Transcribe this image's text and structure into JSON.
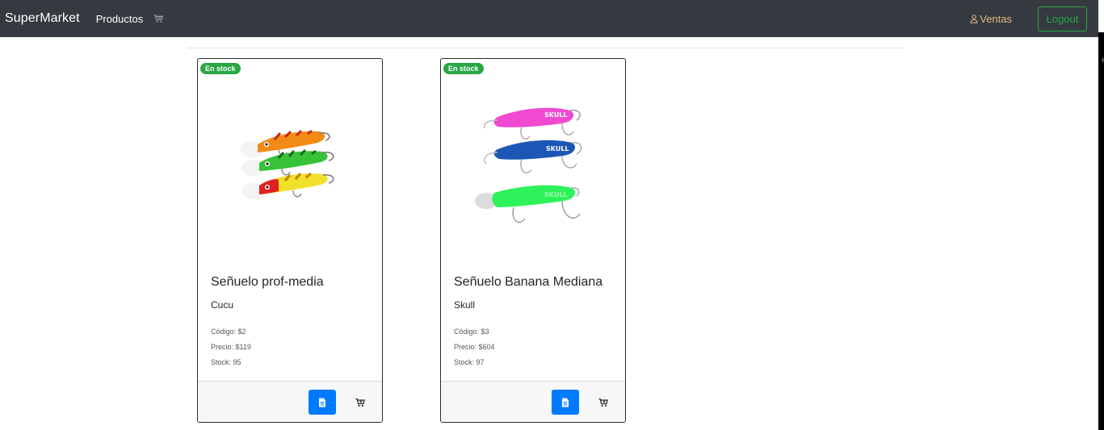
{
  "navbar": {
    "brand": "SuperMarket",
    "nav_link": "Productos",
    "cart_icon": "cart-icon",
    "ventas_label": "Ventas",
    "ventas_icon": "user-icon",
    "logout_label": "Logout"
  },
  "colors": {
    "navbar_bg": "#343a40",
    "badge_green": "#28a745",
    "primary_blue": "#007bff",
    "ventas_gold": "#e4b883"
  },
  "products": [
    {
      "badge": "En stock",
      "title": "Señuelo prof-media",
      "subtitle": "Cucu",
      "codigo": "Código: $2",
      "precio": "Precio: $119",
      "stock": "Stock: 95",
      "detail_icon": "document-icon",
      "cart_icon": "add-to-cart-icon"
    },
    {
      "badge": "En stock",
      "title": "Señuelo Banana Mediana",
      "subtitle": "Skull",
      "codigo": "Código: $3",
      "precio": "Precio: $604",
      "stock": "Stock: 97",
      "detail_icon": "document-icon",
      "cart_icon": "add-to-cart-icon"
    }
  ]
}
